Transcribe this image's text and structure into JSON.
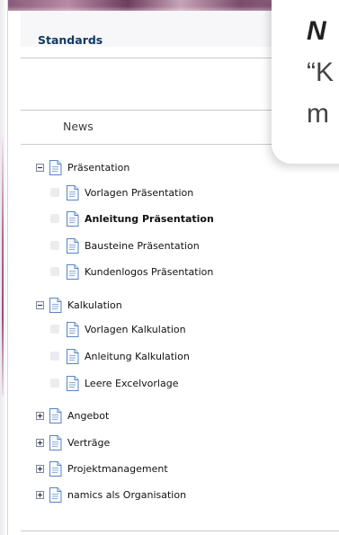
{
  "sidebar": {
    "section_title": "Standards",
    "news_label": "News"
  },
  "tree": [
    {
      "label": "Präsentation",
      "toggle": "minus",
      "bold": false
    },
    {
      "label": "Vorlagen Präsentation",
      "toggle": "none",
      "bold": false
    },
    {
      "label": "Anleitung Präsentation",
      "toggle": "none",
      "bold": true
    },
    {
      "label": "Bausteine Präsentation",
      "toggle": "none",
      "bold": false
    },
    {
      "label": "Kundenlogos Präsentation",
      "toggle": "none",
      "bold": false
    },
    {
      "label": "Kalkulation",
      "toggle": "minus",
      "bold": false
    },
    {
      "label": "Vorlagen Kalkulation",
      "toggle": "none",
      "bold": false
    },
    {
      "label": "Anleitung Kalkulation",
      "toggle": "none",
      "bold": false
    },
    {
      "label": "Leere Excelvorlage",
      "toggle": "none",
      "bold": false
    },
    {
      "label": "Angebot",
      "toggle": "plus",
      "bold": false
    },
    {
      "label": "Verträge",
      "toggle": "plus",
      "bold": false
    },
    {
      "label": "Projektmanagement",
      "toggle": "plus",
      "bold": false
    },
    {
      "label": "namics als Organisation",
      "toggle": "plus",
      "bold": false
    }
  ],
  "overlay": {
    "line1": "N",
    "line2": "“K",
    "line3": "m"
  },
  "colors": {
    "header_gradient_accent": "#8a5a7a",
    "section_title": "#0e3a63",
    "doc_icon_blue": "#5a86c4"
  },
  "icons": {
    "expand": "plus-square-icon",
    "collapse": "minus-square-icon",
    "page": "document-icon"
  }
}
